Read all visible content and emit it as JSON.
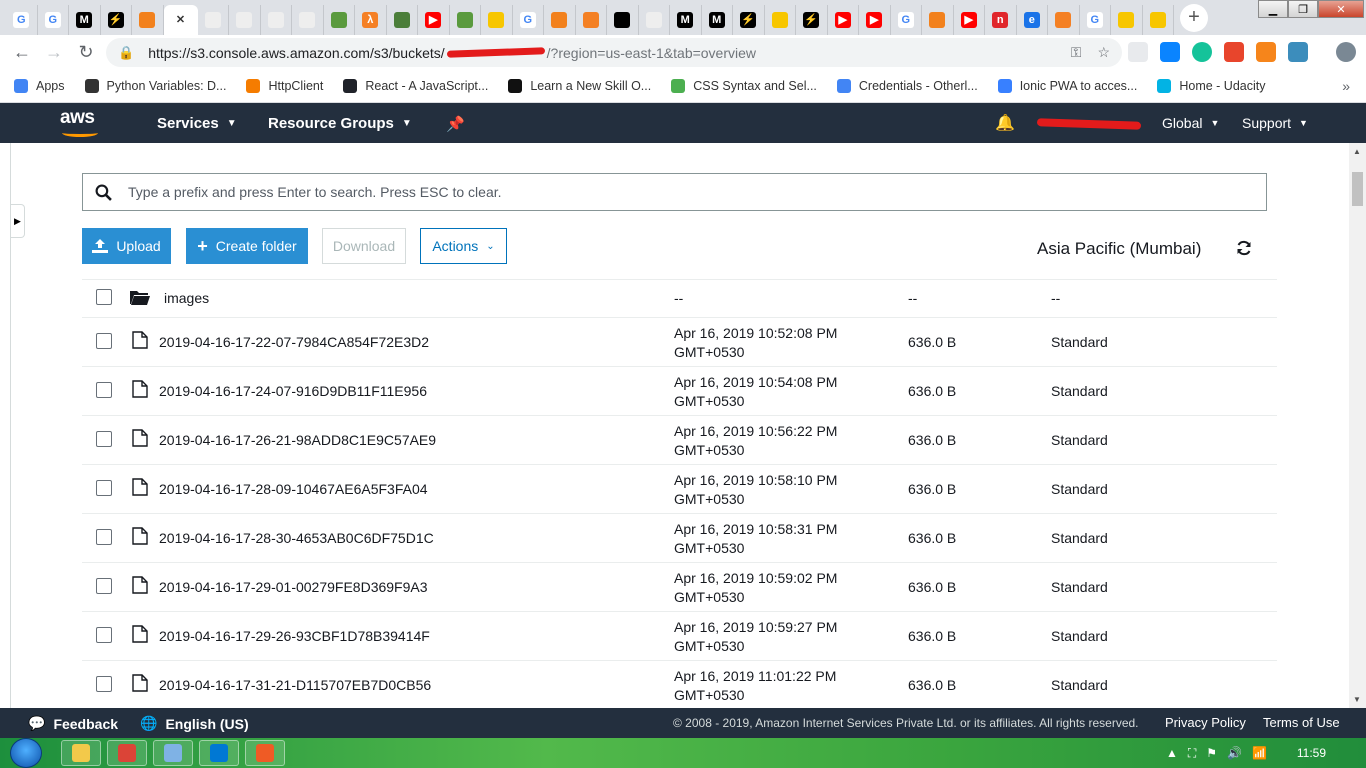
{
  "browser": {
    "tabs": [
      {
        "letter": "G",
        "color": "#4285f4",
        "bg": "#fff"
      },
      {
        "letter": "G",
        "color": "#4285f4",
        "bg": "#fff"
      },
      {
        "letter": "M",
        "color": "#fff",
        "bg": "#000"
      },
      {
        "letter": "⚡",
        "color": "#ffd400",
        "bg": "#000"
      },
      {
        "letter": "",
        "color": "#fff",
        "bg": "#f2811d"
      },
      {
        "letter": "✕",
        "color": "#333",
        "bg": "transparent",
        "active": true
      },
      {
        "letter": "",
        "color": "#888",
        "bg": "#eee"
      },
      {
        "letter": "",
        "color": "#888",
        "bg": "#eee"
      },
      {
        "letter": "",
        "color": "#888",
        "bg": "#eee"
      },
      {
        "letter": "",
        "color": "#888",
        "bg": "#eee"
      },
      {
        "letter": "",
        "color": "#fff",
        "bg": "#5a9a3e"
      },
      {
        "letter": "λ",
        "color": "#fff",
        "bg": "#f58025"
      },
      {
        "letter": "",
        "color": "#fff",
        "bg": "#4b7e3a"
      },
      {
        "letter": "▶",
        "color": "#fff",
        "bg": "#f00"
      },
      {
        "letter": "",
        "color": "#fff",
        "bg": "#5a9a3e"
      },
      {
        "letter": "",
        "color": "#fff",
        "bg": "#f7c600"
      },
      {
        "letter": "G",
        "color": "#4285f4",
        "bg": "#fff"
      },
      {
        "letter": "",
        "color": "#fff",
        "bg": "#f2811d"
      },
      {
        "letter": "",
        "color": "#fff",
        "bg": "#f48024"
      },
      {
        "letter": "",
        "color": "#fff",
        "bg": "#000"
      },
      {
        "letter": "",
        "color": "#888",
        "bg": "#eee"
      },
      {
        "letter": "M",
        "color": "#fff",
        "bg": "#000"
      },
      {
        "letter": "M",
        "color": "#fff",
        "bg": "#000"
      },
      {
        "letter": "⚡",
        "color": "#ffd400",
        "bg": "#000"
      },
      {
        "letter": "",
        "color": "#fff",
        "bg": "#f7c600"
      },
      {
        "letter": "⚡",
        "color": "#ffd400",
        "bg": "#000"
      },
      {
        "letter": "▶",
        "color": "#fff",
        "bg": "#f00"
      },
      {
        "letter": "▶",
        "color": "#fff",
        "bg": "#f00"
      },
      {
        "letter": "G",
        "color": "#4285f4",
        "bg": "#fff"
      },
      {
        "letter": "",
        "color": "#fff",
        "bg": "#f2811d"
      },
      {
        "letter": "▶",
        "color": "#fff",
        "bg": "#f00"
      },
      {
        "letter": "n",
        "color": "#fff",
        "bg": "#e0262b"
      },
      {
        "letter": "e",
        "color": "#fff",
        "bg": "#1a73e8"
      },
      {
        "letter": "",
        "color": "#fff",
        "bg": "#f48024"
      },
      {
        "letter": "G",
        "color": "#4285f4",
        "bg": "#fff"
      },
      {
        "letter": "",
        "color": "#fff",
        "bg": "#f7c600"
      },
      {
        "letter": "",
        "color": "#fff",
        "bg": "#f7c600"
      }
    ],
    "new_tab": "+",
    "url_prefix": "https://s3.console.aws.amazon.com/s3/buckets/",
    "url_suffix": "/?region=us-east-1&tab=overview",
    "bookmarks": [
      {
        "label": "Apps",
        "color": "#4285f4"
      },
      {
        "label": "Python Variables: D...",
        "color": "#333"
      },
      {
        "label": "HttpClient",
        "color": "#f57c00"
      },
      {
        "label": "React - A JavaScript...",
        "color": "#20232a"
      },
      {
        "label": "Learn a New Skill O...",
        "color": "#111"
      },
      {
        "label": "CSS Syntax and Sel...",
        "color": "#4caf50"
      },
      {
        "label": "Credentials - Otherl...",
        "color": "#4285f4"
      },
      {
        "label": "Ionic PWA to acces...",
        "color": "#3880ff"
      },
      {
        "label": "Home - Udacity",
        "color": "#02b3e4"
      }
    ],
    "bookmarks_more": "»"
  },
  "aws_nav": {
    "logo": "aws",
    "services": "Services",
    "resource_groups": "Resource Groups",
    "region_menu": "Global",
    "support_menu": "Support"
  },
  "toolbar": {
    "search_placeholder": "Type a prefix and press Enter to search. Press ESC to clear.",
    "upload": "Upload",
    "create_folder": "Create folder",
    "download": "Download",
    "actions": "Actions",
    "region": "Asia Pacific (Mumbai)"
  },
  "folder": {
    "name": "images",
    "modified": "--",
    "size": "--",
    "storage_class": "--"
  },
  "objects": [
    {
      "name": "2019-04-16-17-22-07-7984CA854F72E3D2",
      "modified_date": "Apr 16, 2019 10:52:08 PM",
      "modified_tz": "GMT+0530",
      "size": "636.0 B",
      "storage_class": "Standard"
    },
    {
      "name": "2019-04-16-17-24-07-916D9DB11F11E956",
      "modified_date": "Apr 16, 2019 10:54:08 PM",
      "modified_tz": "GMT+0530",
      "size": "636.0 B",
      "storage_class": "Standard"
    },
    {
      "name": "2019-04-16-17-26-21-98ADD8C1E9C57AE9",
      "modified_date": "Apr 16, 2019 10:56:22 PM",
      "modified_tz": "GMT+0530",
      "size": "636.0 B",
      "storage_class": "Standard"
    },
    {
      "name": "2019-04-16-17-28-09-10467AE6A5F3FA04",
      "modified_date": "Apr 16, 2019 10:58:10 PM",
      "modified_tz": "GMT+0530",
      "size": "636.0 B",
      "storage_class": "Standard"
    },
    {
      "name": "2019-04-16-17-28-30-4653AB0C6DF75D1C",
      "modified_date": "Apr 16, 2019 10:58:31 PM",
      "modified_tz": "GMT+0530",
      "size": "636.0 B",
      "storage_class": "Standard"
    },
    {
      "name": "2019-04-16-17-29-01-00279FE8D369F9A3",
      "modified_date": "Apr 16, 2019 10:59:02 PM",
      "modified_tz": "GMT+0530",
      "size": "636.0 B",
      "storage_class": "Standard"
    },
    {
      "name": "2019-04-16-17-29-26-93CBF1D78B39414F",
      "modified_date": "Apr 16, 2019 10:59:27 PM",
      "modified_tz": "GMT+0530",
      "size": "636.0 B",
      "storage_class": "Standard"
    },
    {
      "name": "2019-04-16-17-31-21-D115707EB7D0CB56",
      "modified_date": "Apr 16, 2019 11:01:22 PM",
      "modified_tz": "GMT+0530",
      "size": "636.0 B",
      "storage_class": "Standard"
    }
  ],
  "footer": {
    "feedback": "Feedback",
    "language": "English (US)",
    "copyright": "© 2008 - 2019, Amazon Internet Services Private Ltd. or its affiliates. All rights reserved.",
    "privacy": "Privacy Policy",
    "terms": "Terms of Use"
  },
  "taskbar": {
    "clock": "11:59",
    "apps": [
      {
        "name": "explorer",
        "color": "#f3c94a"
      },
      {
        "name": "chrome",
        "color": "#db4437"
      },
      {
        "name": "notepad",
        "color": "#7fb2e5"
      },
      {
        "name": "vscode",
        "color": "#0078d4"
      },
      {
        "name": "postman",
        "color": "#ef5b25"
      }
    ]
  },
  "colors": {
    "aws_nav_bg": "#232f3e",
    "aws_orange": "#ff9900",
    "primary_button": "#2a8fd3",
    "link_blue": "#0073bb"
  }
}
